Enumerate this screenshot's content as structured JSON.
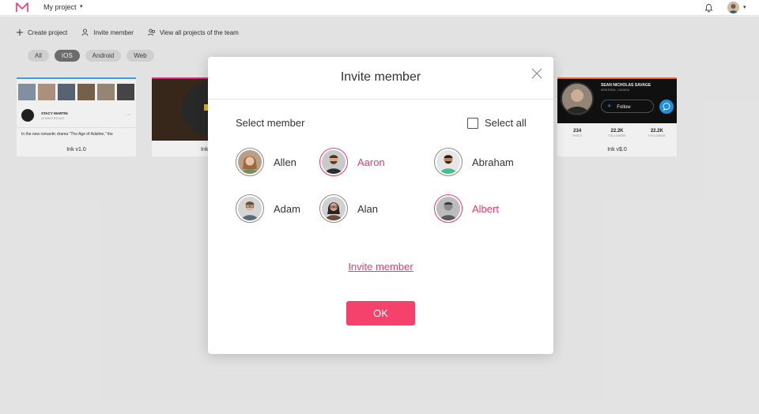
{
  "topbar": {
    "project_name": "My project",
    "caret": "▾"
  },
  "toolbar": {
    "create_project": "Create project",
    "invite_member": "Invite member",
    "view_all": "View all projects of the team"
  },
  "filters": [
    "All",
    "IOS",
    "Android",
    "Web"
  ],
  "filters_active": "IOS",
  "cards": {
    "card1": {
      "label": "Ink v1.0",
      "profile_name": "STACY MARTIN",
      "profile_time": "42 MINUTES AGO",
      "more": "···",
      "text": "In the new romantic drama \"The Age of Adaline,\" the"
    },
    "card2": {
      "label": "Ink"
    },
    "card4": {
      "label": "Ink v$.0",
      "name": "SEAN NICHOLAS SAVAGE",
      "location": "MONTREAL, CANADA",
      "follow": "Follow",
      "stats": [
        {
          "value": "234",
          "label": "POSTS"
        },
        {
          "value": "22.2K",
          "label": "FOLLOWERS"
        },
        {
          "value": "22.2K",
          "label": "FOLLOWING"
        }
      ]
    }
  },
  "modal": {
    "title": "Invite member",
    "select_label": "Select member",
    "select_all": "Select all",
    "members": [
      {
        "name": "Allen",
        "selected": false
      },
      {
        "name": "Aaron",
        "selected": true
      },
      {
        "name": "Abraham",
        "selected": false
      },
      {
        "name": "Adam",
        "selected": false
      },
      {
        "name": "Alan",
        "selected": false
      },
      {
        "name": "Albert",
        "selected": true
      }
    ],
    "invite_link": "Invite member",
    "ok": "OK"
  },
  "colors": {
    "accent": "#f0396a",
    "ok_button": "#f5426d",
    "chip_active": "#737373"
  }
}
